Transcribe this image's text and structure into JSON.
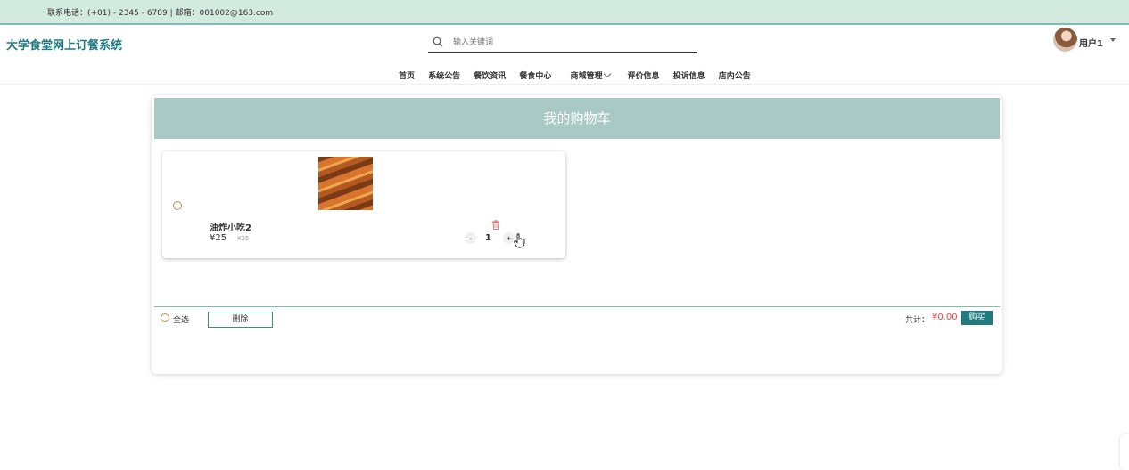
{
  "topbar": {
    "contact": "联系电话：(+01) - 2345 - 6789 | 邮箱：001002@163.com"
  },
  "header": {
    "logo": "大学食堂网上订餐系统",
    "search_placeholder": "输入关键词",
    "user_name": "用户1"
  },
  "nav": {
    "items": [
      "首页",
      "系统公告",
      "餐饮资讯",
      "餐食中心",
      "商城管理",
      "评价信息",
      "投诉信息",
      "店内公告"
    ]
  },
  "cart": {
    "title": "我的购物车",
    "items": [
      {
        "name": "油炸小吃2",
        "price": "¥25",
        "original_price": "¥25",
        "quantity": "1",
        "minus": "-",
        "plus": "+"
      }
    ],
    "select_all": "全选",
    "delete_label": "删除",
    "total_label": "共计：",
    "total_value": "¥0.00",
    "buy_label": "购买"
  },
  "colors": {
    "accent": "#217a7f",
    "header_band": "#a9c9c4",
    "topbar": "#d3eadf",
    "price_red": "#e24a4a"
  }
}
